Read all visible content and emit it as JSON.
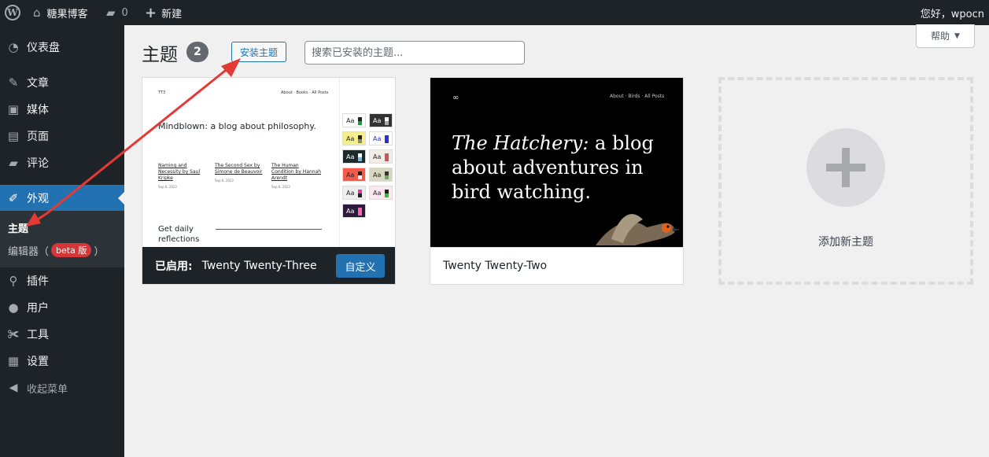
{
  "adminbar": {
    "site_name": "糖果博客",
    "comment_count": "0",
    "new_label": "新建",
    "greeting": "您好，wpocn"
  },
  "sidebar": {
    "items": [
      {
        "label": "仪表盘",
        "icon": "dashboard-icon"
      },
      {
        "label": "文章",
        "icon": "pin-icon"
      },
      {
        "label": "媒体",
        "icon": "media-icon"
      },
      {
        "label": "页面",
        "icon": "page-icon"
      },
      {
        "label": "评论",
        "icon": "comment-icon"
      },
      {
        "label": "外观",
        "icon": "brush-icon"
      },
      {
        "label": "插件",
        "icon": "plugin-icon"
      },
      {
        "label": "用户",
        "icon": "user-icon"
      },
      {
        "label": "工具",
        "icon": "wrench-icon"
      },
      {
        "label": "设置",
        "icon": "settings-icon"
      }
    ],
    "submenu": {
      "themes": "主题",
      "editor": "编辑器（",
      "beta": "beta 版",
      "editor_close": "）"
    },
    "collapse": "收起菜单"
  },
  "header": {
    "title": "主题",
    "count": "2",
    "install_button": "安装主题",
    "search_placeholder": "搜索已安装的主题...",
    "help_label": "帮助",
    "help_caret": "▼"
  },
  "themes": [
    {
      "name": "Twenty Twenty-Three",
      "active_label": "已启用:",
      "customize_label": "自定义",
      "preview": {
        "headline": "Mindblown: a blog about philosophy.",
        "posts": [
          {
            "title": "Naming and Necessity by Saul Kripke",
            "date": "Sep 6, 2022"
          },
          {
            "title": "The Second Sex by Simone de Beauvoir",
            "date": "Sep 6, 2022"
          },
          {
            "title": "The Human Condition by Hannah Arendt",
            "date": "Sep 6, 2022"
          }
        ],
        "footer_line1": "Get daily",
        "footer_line2": "reflections",
        "swatch_label": "Aa"
      }
    },
    {
      "name": "Twenty Twenty-Two",
      "preview": {
        "headline_italic": "The Hatchery:",
        "headline_rest": " a blog about adventures in bird watching."
      }
    }
  ],
  "add_new": {
    "label": "添加新主题"
  },
  "colors": {
    "admin_dark": "#1d2327",
    "accent_blue": "#2271b1",
    "annotation_red": "#e53935"
  }
}
